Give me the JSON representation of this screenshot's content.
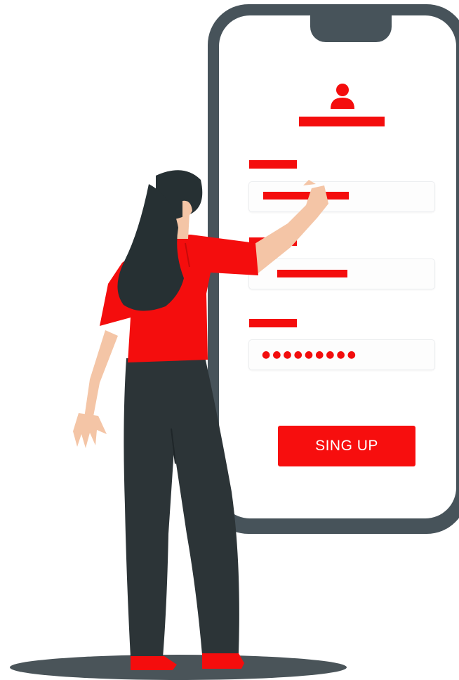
{
  "signup_form": {
    "password_mask": "●●●●●●●●●",
    "submit_label": "SING UP"
  },
  "colors": {
    "accent": "#f40d0d",
    "phone_frame": "#47535a",
    "pants": "#2c3437",
    "hair": "#263033",
    "skin": "#f4c5a6"
  },
  "icons": [
    "user-icon"
  ]
}
